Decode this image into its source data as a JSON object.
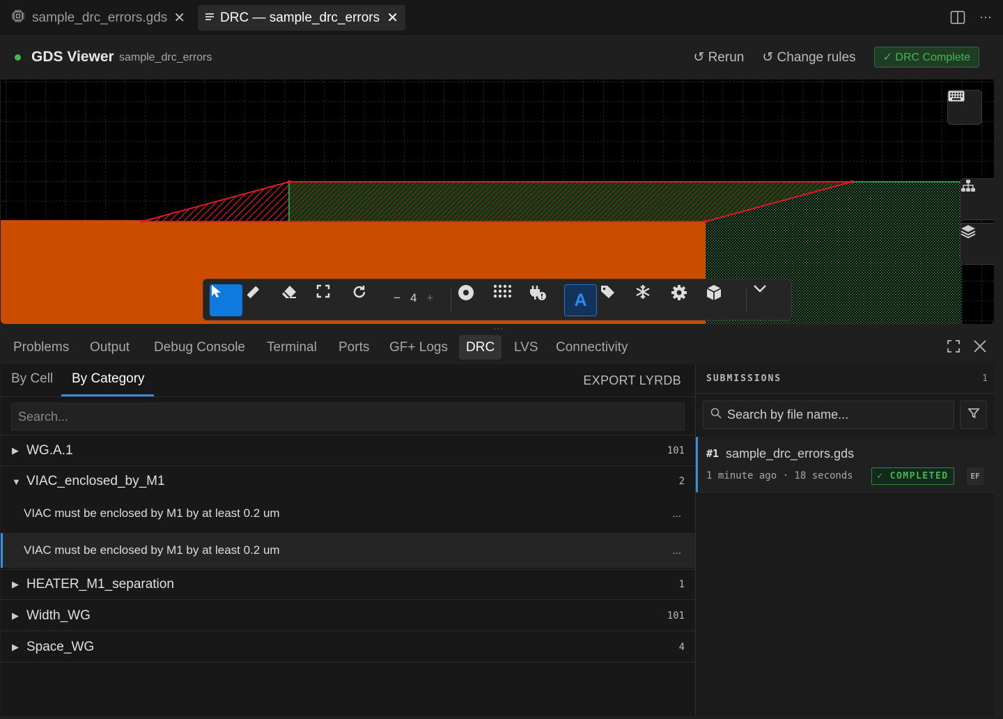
{
  "tabs": [
    {
      "label": "sample_drc_errors.gds",
      "icon": "chip-icon"
    },
    {
      "label": "DRC — sample_drc_errors",
      "icon": "lines-icon"
    }
  ],
  "viewer": {
    "title": "GDS Viewer",
    "subtitle": "sample_drc_errors",
    "rerun": "↺ Rerun",
    "change_rules": "↺ Change rules",
    "status_badge": "✓ DRC Complete",
    "zoom_value": "4"
  },
  "colors": {
    "accent": "#0e7ae0",
    "status_green": "#3fb950",
    "metal_orange": "#cc4c00",
    "error_red": "#e01b24",
    "hatch_green": "#1fa34a"
  },
  "panel_tabs": [
    "Problems",
    "Output",
    "Debug Console",
    "Terminal",
    "Ports",
    "GF+ Logs",
    "DRC",
    "LVS",
    "Connectivity"
  ],
  "drc": {
    "subtabs": [
      "By Cell",
      "By Category"
    ],
    "export_label": "EXPORT LYRDB",
    "search_placeholder": "Search...",
    "categories": [
      {
        "name": "WG.A.1",
        "count": "101",
        "expanded": false
      },
      {
        "name": "VIAC_enclosed_by_M1",
        "count": "2",
        "expanded": true
      },
      {
        "name": "HEATER_M1_separation",
        "count": "1",
        "expanded": false
      },
      {
        "name": "Width_WG",
        "count": "101",
        "expanded": false
      },
      {
        "name": "Space_WG",
        "count": "4",
        "expanded": false
      }
    ],
    "violations": [
      {
        "message": "VIAC must be enclosed by M1 by at least 0.2 um",
        "more": "..."
      },
      {
        "message": "VIAC must be enclosed by M1 by at least 0.2 um",
        "more": "..."
      }
    ]
  },
  "submissions": {
    "label": "SUBMISSIONS",
    "count": "1",
    "search_placeholder": "Search by file name...",
    "items": [
      {
        "index": "#1",
        "file": "sample_drc_errors.gds",
        "meta": "1 minute ago · 18 seconds",
        "status": "✓ COMPLETED",
        "tag": "EF"
      }
    ]
  }
}
